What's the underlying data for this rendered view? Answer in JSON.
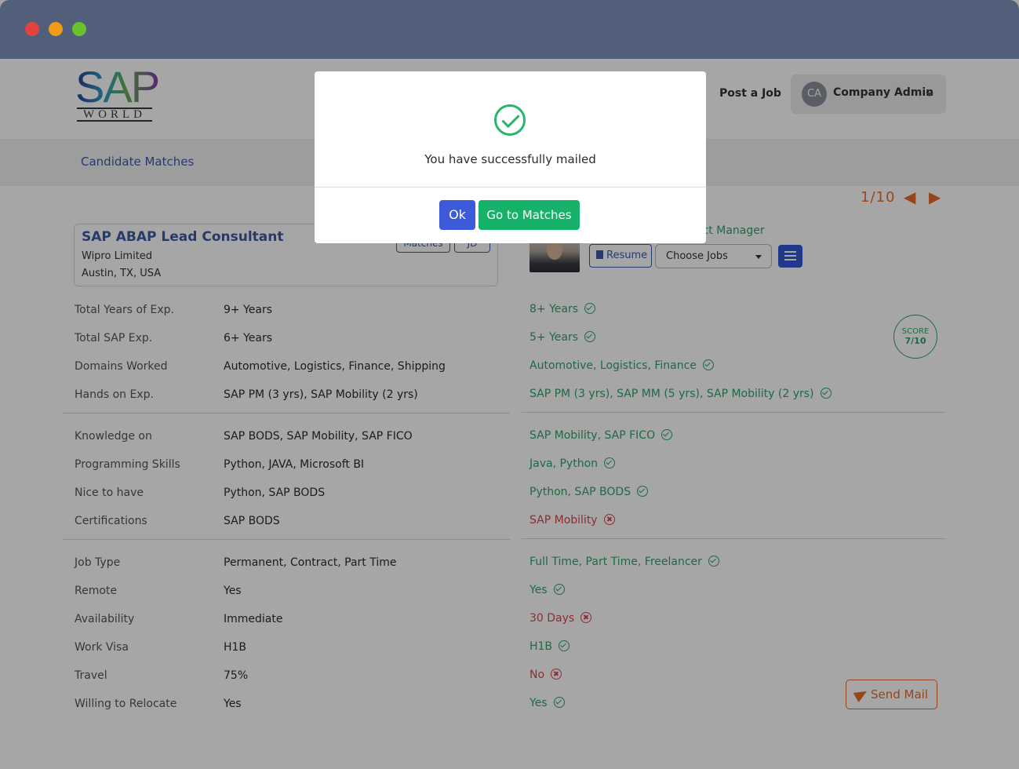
{
  "header": {
    "logo_main": "SAP",
    "logo_sub": "WORLD",
    "post_job": "Post a Job",
    "user_initials": "CA",
    "user_name": "Company Admin"
  },
  "subnav": {
    "title": "Candidate Matches"
  },
  "pager": {
    "text": "1/10"
  },
  "job": {
    "title": "SAP ABAP Lead Consultant",
    "company": "Wipro Limited",
    "location": "Austin, TX, USA",
    "matches_label": "Matches",
    "jd_label": "JD"
  },
  "candidate": {
    "role": "ect Manager",
    "resume_label": "Resume",
    "choose_jobs": "Choose Jobs"
  },
  "score": {
    "label": "SCORE",
    "value": "7/10"
  },
  "rows": [
    {
      "label": "Total Years of Exp.",
      "value": "9+ Years",
      "match": "8+ Years",
      "status": "ok"
    },
    {
      "label": "Total SAP Exp.",
      "value": "6+ Years",
      "match": "5+ Years",
      "status": "ok"
    },
    {
      "label": "Domains Worked",
      "value": "Automotive, Logistics, Finance, Shipping",
      "match": "Automotive, Logistics, Finance",
      "status": "ok"
    },
    {
      "label": "Hands on Exp.",
      "value": "SAP PM (3 yrs), SAP Mobility (2 yrs)",
      "match": "SAP PM (3 yrs), SAP MM (5 yrs), SAP Mobility (2 yrs)",
      "status": "ok"
    },
    {
      "label": "Knowledge on",
      "value": "SAP BODS, SAP Mobility, SAP FICO",
      "match": "SAP Mobility, SAP FICO",
      "status": "ok"
    },
    {
      "label": "Programming Skills",
      "value": "Python, JAVA, Microsoft BI",
      "match": "Java, Python",
      "status": "ok"
    },
    {
      "label": "Nice to have",
      "value": "Python, SAP BODS",
      "match": "Python, SAP BODS",
      "status": "ok"
    },
    {
      "label": "Certifications",
      "value": "SAP BODS",
      "match": "SAP Mobility",
      "status": "bad"
    },
    {
      "label": "Job Type",
      "value": "Permanent, Contract, Part Time",
      "match": "Full Time, Part Time, Freelancer",
      "status": "ok"
    },
    {
      "label": "Remote",
      "value": "Yes",
      "match": "Yes",
      "status": "ok"
    },
    {
      "label": "Availability",
      "value": "Immediate",
      "match": "30 Days",
      "status": "bad"
    },
    {
      "label": "Work Visa",
      "value": "H1B",
      "match": "H1B",
      "status": "ok"
    },
    {
      "label": "Travel",
      "value": "75%",
      "match": "No",
      "status": "bad"
    },
    {
      "label": "Willing to Relocate",
      "value": "Yes",
      "match": "Yes",
      "status": "ok"
    }
  ],
  "send_mail": "Send Mail",
  "modal": {
    "message": "You have successfully mailed",
    "ok_label": "Ok",
    "goto_label": "Go to Matches"
  }
}
